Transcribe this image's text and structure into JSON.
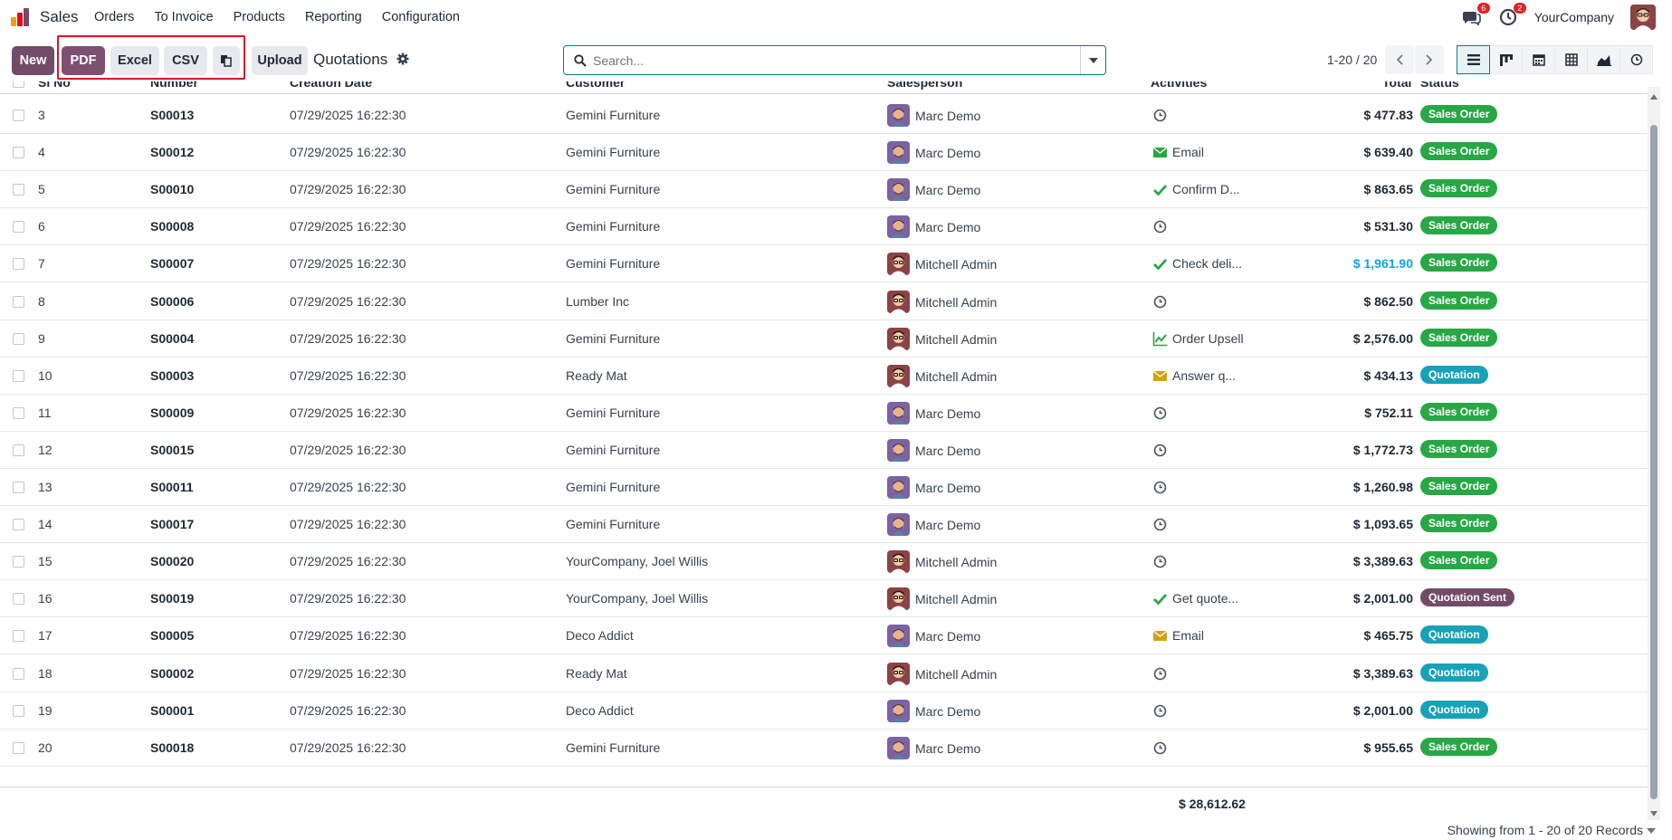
{
  "app": {
    "name": "Sales"
  },
  "menu": [
    "Orders",
    "To Invoice",
    "Products",
    "Reporting",
    "Configuration"
  ],
  "systray": {
    "messages_count": "6",
    "activities_count": "2",
    "company": "YourCompany"
  },
  "toolbar": {
    "new": "New",
    "pdf": "PDF",
    "excel": "Excel",
    "csv": "CSV",
    "upload": "Upload"
  },
  "breadcrumb": "Quotations",
  "search": {
    "placeholder": "Search..."
  },
  "pager": "1-20 / 20",
  "columns": {
    "sl_no": "Sl No",
    "number": "Number",
    "creation_date": "Creation Date",
    "customer": "Customer",
    "salesperson": "Salesperson",
    "activities": "Activities",
    "total": "Total",
    "status": "Status"
  },
  "rows": [
    {
      "sl": "3",
      "number": "S00013",
      "date": "07/29/2025 16:22:30",
      "customer": "Gemini Furniture",
      "salesperson": "Marc Demo",
      "activity": "",
      "activity_icon": "clock-icon",
      "total": "$ 477.83",
      "status": "Sales Order"
    },
    {
      "sl": "4",
      "number": "S00012",
      "date": "07/29/2025 16:22:30",
      "customer": "Gemini Furniture",
      "salesperson": "Marc Demo",
      "activity": "Email",
      "activity_icon": "email-icon",
      "total": "$ 639.40",
      "status": "Sales Order"
    },
    {
      "sl": "5",
      "number": "S00010",
      "date": "07/29/2025 16:22:30",
      "customer": "Gemini Furniture",
      "salesperson": "Marc Demo",
      "activity": "Confirm D...",
      "activity_icon": "check-icon",
      "total": "$ 863.65",
      "status": "Sales Order"
    },
    {
      "sl": "6",
      "number": "S00008",
      "date": "07/29/2025 16:22:30",
      "customer": "Gemini Furniture",
      "salesperson": "Marc Demo",
      "activity": "",
      "activity_icon": "clock-icon",
      "total": "$ 531.30",
      "status": "Sales Order"
    },
    {
      "sl": "7",
      "number": "S00007",
      "date": "07/29/2025 16:22:30",
      "customer": "Gemini Furniture",
      "salesperson": "Mitchell Admin",
      "activity": "Check deli...",
      "activity_icon": "check-icon",
      "total": "$ 1,961.90",
      "status": "Sales Order"
    },
    {
      "sl": "8",
      "number": "S00006",
      "date": "07/29/2025 16:22:30",
      "customer": "Lumber Inc",
      "salesperson": "Mitchell Admin",
      "activity": "",
      "activity_icon": "clock-icon",
      "total": "$ 862.50",
      "status": "Sales Order"
    },
    {
      "sl": "9",
      "number": "S00004",
      "date": "07/29/2025 16:22:30",
      "customer": "Gemini Furniture",
      "salesperson": "Mitchell Admin",
      "activity": "Order Upsell",
      "activity_icon": "chart-icon",
      "total": "$ 2,576.00",
      "status": "Sales Order"
    },
    {
      "sl": "10",
      "number": "S00003",
      "date": "07/29/2025 16:22:30",
      "customer": "Ready Mat",
      "salesperson": "Mitchell Admin",
      "activity": "Answer q...",
      "activity_icon": "envelope-icon",
      "total": "$ 434.13",
      "status": "Quotation"
    },
    {
      "sl": "11",
      "number": "S00009",
      "date": "07/29/2025 16:22:30",
      "customer": "Gemini Furniture",
      "salesperson": "Marc Demo",
      "activity": "",
      "activity_icon": "clock-icon",
      "total": "$ 752.11",
      "status": "Sales Order"
    },
    {
      "sl": "12",
      "number": "S00015",
      "date": "07/29/2025 16:22:30",
      "customer": "Gemini Furniture",
      "salesperson": "Marc Demo",
      "activity": "",
      "activity_icon": "clock-icon",
      "total": "$ 1,772.73",
      "status": "Sales Order"
    },
    {
      "sl": "13",
      "number": "S00011",
      "date": "07/29/2025 16:22:30",
      "customer": "Gemini Furniture",
      "salesperson": "Marc Demo",
      "activity": "",
      "activity_icon": "clock-icon",
      "total": "$ 1,260.98",
      "status": "Sales Order"
    },
    {
      "sl": "14",
      "number": "S00017",
      "date": "07/29/2025 16:22:30",
      "customer": "Gemini Furniture",
      "salesperson": "Marc Demo",
      "activity": "",
      "activity_icon": "clock-icon",
      "total": "$ 1,093.65",
      "status": "Sales Order"
    },
    {
      "sl": "15",
      "number": "S00020",
      "date": "07/29/2025 16:22:30",
      "customer": "YourCompany, Joel Willis",
      "salesperson": "Mitchell Admin",
      "activity": "",
      "activity_icon": "clock-icon",
      "total": "$ 3,389.63",
      "status": "Sales Order"
    },
    {
      "sl": "16",
      "number": "S00019",
      "date": "07/29/2025 16:22:30",
      "customer": "YourCompany, Joel Willis",
      "salesperson": "Mitchell Admin",
      "activity": "Get quote...",
      "activity_icon": "check-icon",
      "total": "$ 2,001.00",
      "status": "Quotation Sent"
    },
    {
      "sl": "17",
      "number": "S00005",
      "date": "07/29/2025 16:22:30",
      "customer": "Deco Addict",
      "salesperson": "Marc Demo",
      "activity": "Email",
      "activity_icon": "envelope-icon",
      "total": "$ 465.75",
      "status": "Quotation"
    },
    {
      "sl": "18",
      "number": "S00002",
      "date": "07/29/2025 16:22:30",
      "customer": "Ready Mat",
      "salesperson": "Mitchell Admin",
      "activity": "",
      "activity_icon": "clock-icon",
      "total": "$ 3,389.63",
      "status": "Quotation"
    },
    {
      "sl": "19",
      "number": "S00001",
      "date": "07/29/2025 16:22:30",
      "customer": "Deco Addict",
      "salesperson": "Marc Demo",
      "activity": "",
      "activity_icon": "clock-icon",
      "total": "$ 2,001.00",
      "status": "Quotation"
    },
    {
      "sl": "20",
      "number": "S00018",
      "date": "07/29/2025 16:22:30",
      "customer": "Gemini Furniture",
      "salesperson": "Marc Demo",
      "activity": "",
      "activity_icon": "clock-icon",
      "total": "$ 955.65",
      "status": "Sales Order"
    }
  ],
  "grand_total": "$ 28,612.62",
  "showing": "Showing from 1 - 20 of 20 Records",
  "colors": {
    "brand": "#714b67",
    "accent": "#017e84",
    "sales_order": "#28a745",
    "quotation": "#17a2b8",
    "highlight": "#e0101f"
  }
}
